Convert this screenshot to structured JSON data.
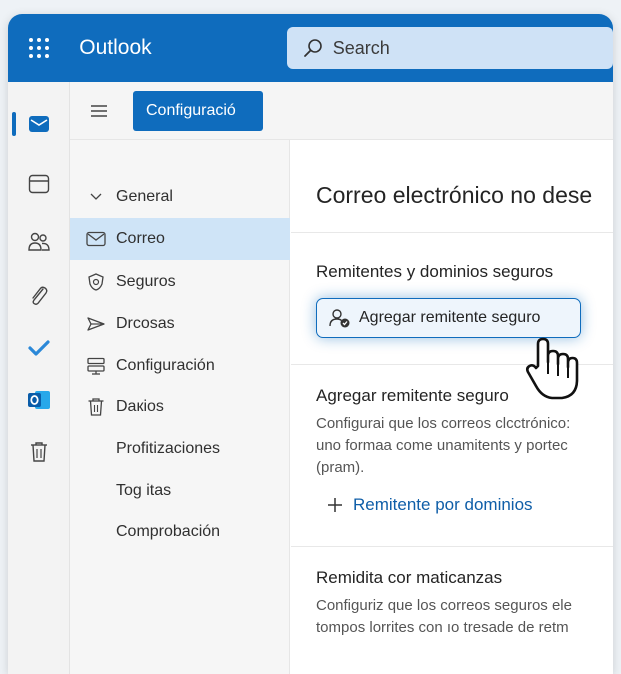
{
  "header": {
    "app_title": "Outlook",
    "search_placeholder": "Search",
    "brand_color": "#0f6cbd"
  },
  "rail": {
    "items": [
      {
        "icon": "mail-icon",
        "active": true
      },
      {
        "icon": "calendar-icon"
      },
      {
        "icon": "people-icon"
      },
      {
        "icon": "attach-icon"
      },
      {
        "icon": "todo-check-icon"
      },
      {
        "icon": "outlook-icon"
      },
      {
        "icon": "trash-icon"
      }
    ]
  },
  "command_bar": {
    "settings_label": "Configuració"
  },
  "nav": {
    "items": [
      {
        "label": "General",
        "icon": "chevron-down-icon"
      },
      {
        "label": "Correo",
        "icon": "mail-icon",
        "selected": true
      },
      {
        "label": "Seguros",
        "icon": "shield-icon"
      },
      {
        "label": "Drcosas",
        "icon": "send-icon"
      },
      {
        "label": "Configuración",
        "icon": "settings-rows-icon"
      },
      {
        "label": "Daкios",
        "icon": "trash-icon"
      },
      {
        "label": "Profitizaciones"
      },
      {
        "label": "Tog itas"
      },
      {
        "label": "Comprobación"
      }
    ]
  },
  "content": {
    "title": "Correo electrónico no dese",
    "safe_section": {
      "heading": "Remitentes y dominios seguros",
      "button_label": "Agregar remitente seguro"
    },
    "add_section": {
      "heading": "Agregar remitente seguro",
      "text": [
        "Configurai que los correos clcctrónico:",
        "uno formaa come unamitents y portec",
        "(pram)."
      ],
      "add_domain_label": "Remitente por dominios"
    },
    "third_section": {
      "heading": "Remidita cor maticanzas",
      "text": [
        "Configuriz que los correos seguros ele",
        "tompos lorrites con ıo tresade de retm"
      ]
    }
  }
}
